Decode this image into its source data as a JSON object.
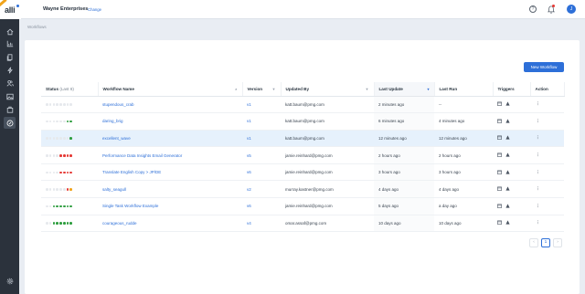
{
  "header": {
    "org_name": "Wayne Enterprises",
    "change_label": "Change",
    "help_label": "?",
    "avatar_initial": "J"
  },
  "sidebar": {
    "items": [
      {
        "icon": "home-icon"
      },
      {
        "icon": "chart-icon"
      },
      {
        "icon": "documents-icon"
      },
      {
        "icon": "lightning-icon"
      },
      {
        "icon": "users-icon"
      },
      {
        "icon": "image-icon"
      },
      {
        "icon": "bag-icon"
      },
      {
        "icon": "workflow-icon",
        "active": true
      }
    ],
    "settings_icon": "gear-icon"
  },
  "breadcrumb": "Workflows",
  "toolbar": {
    "new_workflow_label": "New Workflow"
  },
  "columns": {
    "status": "Status",
    "status_sub": "(Last 8)",
    "workflow_name": "Workflow Name",
    "version": "Version",
    "updated_by": "Updated By",
    "last_update": "Last Update",
    "last_run": "Last Run",
    "triggers": "Triggers",
    "action": "Action"
  },
  "status_colors": {
    "success": "#2e9e3f",
    "failed": "#e53935",
    "warning": "#f0a31a",
    "none": "#e6e9ed"
  },
  "rows": [
    {
      "status": [
        "none",
        "none",
        "none",
        "none",
        "none",
        "none",
        "none",
        "none"
      ],
      "name": "stupendous_crab",
      "version": "v1",
      "updated_by": "katt.baum@pmg.com",
      "last_update": "2 minutes ago",
      "last_run": "--"
    },
    {
      "status": [
        "none",
        "none",
        "none",
        "none",
        "none",
        "none",
        "success",
        "success"
      ],
      "name": "daring_brig",
      "version": "v1",
      "updated_by": "katt.baum@pmg.com",
      "last_update": "6 minutes ago",
      "last_run": "4 minutes ago"
    },
    {
      "status": [
        "none",
        "none",
        "none",
        "none",
        "none",
        "none",
        "none",
        "success"
      ],
      "name": "excellent_wave",
      "version": "v1",
      "updated_by": "katt.baum@pmg.com",
      "last_update": "12 minutes ago",
      "last_run": "12 minutes ago",
      "highlight": true
    },
    {
      "status": [
        "none",
        "none",
        "none",
        "none",
        "failed",
        "failed",
        "failed",
        "failed"
      ],
      "name": "Performance Data Insights Email Generator",
      "version": "v5",
      "updated_by": "jamie.reinhard@pmg.com",
      "last_update": "2 hours ago",
      "last_run": "2 hours ago"
    },
    {
      "status": [
        "none",
        "none",
        "none",
        "none",
        "failed",
        "failed",
        "failed",
        "failed"
      ],
      "name": "Translate English Copy > JP/DE",
      "version": "v6",
      "updated_by": "jamie.reinhard@pmg.com",
      "last_update": "3 hours ago",
      "last_run": "3 hours ago"
    },
    {
      "status": [
        "none",
        "none",
        "none",
        "none",
        "none",
        "none",
        "failed",
        "warning"
      ],
      "name": "salty_seagull",
      "version": "v2",
      "updated_by": "murray.kastner@pmg.com",
      "last_update": "4 days ago",
      "last_run": "4 days ago"
    },
    {
      "status": [
        "none",
        "none",
        "success",
        "success",
        "success",
        "success",
        "success",
        "success"
      ],
      "name": "Single Task Workflow Example",
      "version": "v6",
      "updated_by": "jamie.reinhard@pmg.com",
      "last_update": "5 days ago",
      "last_run": "a day ago"
    },
    {
      "status": [
        "none",
        "none",
        "success",
        "success",
        "success",
        "success",
        "success",
        "success"
      ],
      "name": "courageous_rudde",
      "version": "v4",
      "updated_by": "omar.assaf@pmg.com",
      "last_update": "10 days ago",
      "last_run": "10 days ago"
    }
  ],
  "pagination": {
    "prev_label": "‹",
    "current_page": "1",
    "next_label": "›"
  }
}
